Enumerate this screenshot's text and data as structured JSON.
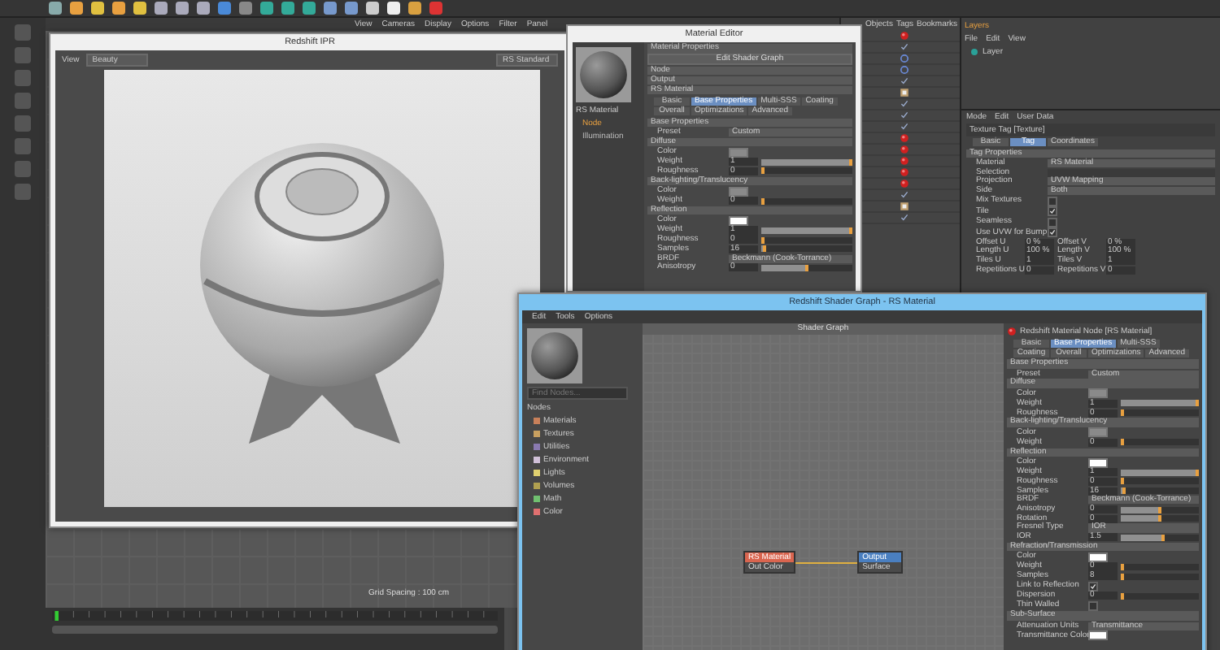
{
  "viewport": {
    "menu": [
      "View",
      "Cameras",
      "Display",
      "Options",
      "Filter",
      "Panel"
    ],
    "grid_spacing": "Grid Spacing : 100 cm"
  },
  "ipr": {
    "title": "Redshift IPR",
    "menu": [
      "View"
    ],
    "dropdown": "Beauty",
    "aov": "RS Standard"
  },
  "object_manager": {
    "menu": [
      "Objects",
      "Tags",
      "Bookmarks"
    ],
    "rows": [
      {
        "kind": "material"
      },
      {
        "kind": "plain"
      },
      {
        "kind": "null"
      },
      {
        "kind": "null"
      },
      {
        "kind": "plain"
      },
      {
        "kind": "texture"
      },
      {
        "kind": "plain"
      },
      {
        "kind": "plain"
      },
      {
        "kind": "plain"
      },
      {
        "kind": "material"
      },
      {
        "kind": "material"
      },
      {
        "kind": "material"
      },
      {
        "kind": "material"
      },
      {
        "kind": "material"
      },
      {
        "kind": "plain"
      },
      {
        "kind": "texture"
      },
      {
        "kind": "plain"
      }
    ]
  },
  "layers": {
    "tab": "Layers",
    "menu": [
      "File",
      "Edit",
      "View"
    ],
    "rows": [
      {
        "label": "Layer",
        "color": "#2aa198"
      }
    ]
  },
  "attributes": {
    "menu": [
      "Mode",
      "Edit",
      "User Data"
    ],
    "title": "Texture Tag [Texture]",
    "props": [
      {
        "kind": "tabs",
        "tabs": [
          {
            "label": "Basic",
            "selected": false
          },
          {
            "label": "Tag",
            "selected": true
          },
          {
            "label": "Coordinates",
            "selected": false
          }
        ]
      },
      {
        "kind": "section",
        "label": "Tag Properties"
      },
      {
        "kind": "dropdown",
        "label": "Material",
        "value": "RS Material"
      },
      {
        "kind": "text",
        "label": "Selection"
      },
      {
        "kind": "dropdown",
        "label": "Projection",
        "value": "UVW Mapping"
      },
      {
        "kind": "dropdown",
        "label": "Side",
        "value": "Both"
      },
      {
        "kind": "check",
        "label": "Mix Textures",
        "checked": false
      },
      {
        "kind": "check",
        "label": "Tile",
        "checked": true
      },
      {
        "kind": "check",
        "label": "Seamless",
        "checked": false
      },
      {
        "kind": "check",
        "label": "Use UVW for Bump",
        "checked": true
      },
      {
        "kind": "pair",
        "label": "Offset U",
        "value": "0 %",
        "label2": "Offset V",
        "value2": "0 %"
      },
      {
        "kind": "pair",
        "label": "Length U",
        "value": "100 %",
        "label2": "Length V",
        "value2": "100 %"
      },
      {
        "kind": "pair",
        "label": "Tiles U",
        "value": "1",
        "label2": "Tiles V",
        "value2": "1"
      },
      {
        "kind": "pair",
        "label": "Repetitions U",
        "value": "0",
        "label2": "Repetitions V",
        "value2": "0"
      }
    ]
  },
  "material_editor": {
    "title": "Material Editor",
    "material": "RS Material",
    "channels": [
      {
        "label": "Node",
        "selected": true
      },
      {
        "label": "Illumination",
        "selected": false
      }
    ],
    "props": [
      {
        "kind": "section",
        "label": "Material Properties"
      },
      {
        "kind": "button",
        "label": "Edit Shader Graph"
      },
      {
        "kind": "section",
        "label": "Node"
      },
      {
        "kind": "section",
        "label": "Output"
      },
      {
        "kind": "section",
        "label": "RS Material"
      },
      {
        "kind": "tabs",
        "tabs": [
          {
            "label": "Basic",
            "selected": false
          },
          {
            "label": "Base Properties",
            "selected": true
          },
          {
            "label": "Multi-SSS",
            "selected": false
          },
          {
            "label": "Coating",
            "selected": false
          },
          {
            "label": "Overall",
            "selected": false
          },
          {
            "label": "Optimizations",
            "selected": false
          },
          {
            "label": "Advanced",
            "selected": false
          }
        ]
      },
      {
        "kind": "section",
        "label": "Base Properties"
      },
      {
        "kind": "dropdown",
        "label": "Preset",
        "value": "Custom"
      },
      {
        "kind": "section",
        "label": "Diffuse"
      },
      {
        "kind": "color",
        "label": "Color",
        "color": "#8a8a8a"
      },
      {
        "kind": "number",
        "label": "Weight",
        "value": "1",
        "level": 1
      },
      {
        "kind": "number",
        "label": "Roughness",
        "value": "0",
        "level": 0
      },
      {
        "kind": "section",
        "label": "Back-lighting/Translucency"
      },
      {
        "kind": "color",
        "label": "Color",
        "color": "#8a8a8a"
      },
      {
        "kind": "number",
        "label": "Weight",
        "value": "0",
        "level": 0
      },
      {
        "kind": "section",
        "label": "Reflection"
      },
      {
        "kind": "color",
        "label": "Color",
        "color": "#ffffff"
      },
      {
        "kind": "number",
        "label": "Weight",
        "value": "1",
        "level": 1
      },
      {
        "kind": "number",
        "label": "Roughness",
        "value": "0",
        "level": 0
      },
      {
        "kind": "number",
        "label": "Samples",
        "value": "16",
        "level": 0.02
      },
      {
        "kind": "dropdown",
        "label": "BRDF",
        "value": "Beckmann (Cook-Torrance)"
      },
      {
        "kind": "number",
        "label": "Anisotropy",
        "value": "0",
        "level": 0.5
      }
    ]
  },
  "shader_graph": {
    "title": "Redshift Shader Graph - RS Material",
    "menu": [
      "Edit",
      "Tools",
      "Options"
    ],
    "search": {
      "placeholder": "Find Nodes..."
    },
    "nodes_header": "Nodes",
    "categories": [
      {
        "label": "Materials",
        "color": "#c8805a"
      },
      {
        "label": "Textures",
        "color": "#c8a060"
      },
      {
        "label": "Utilities",
        "color": "#8a7ab0"
      },
      {
        "label": "Environment",
        "color": "#d0c0d8"
      },
      {
        "label": "Lights",
        "color": "#e0d070"
      },
      {
        "label": "Volumes",
        "color": "#b0a050"
      },
      {
        "label": "Math",
        "color": "#70c070"
      },
      {
        "label": "Color",
        "color": "#e07070"
      }
    ],
    "canvas_title": "Shader Graph",
    "graph_nodes": [
      {
        "title": "RS Material",
        "port": "Out Color",
        "color": "#d9654f"
      },
      {
        "title": "Output",
        "port": "Surface",
        "color": "#4a7fc0"
      }
    ],
    "panel_title": "Redshift Material Node [RS Material]",
    "props": [
      {
        "kind": "tabs",
        "tabs": [
          {
            "label": "Basic",
            "selected": false
          },
          {
            "label": "Base Properties",
            "selected": true
          },
          {
            "label": "Multi-SSS",
            "selected": false
          },
          {
            "label": "Coating",
            "selected": false
          },
          {
            "label": "Overall",
            "selected": false
          },
          {
            "label": "Optimizations",
            "selected": false
          },
          {
            "label": "Advanced",
            "selected": false
          }
        ]
      },
      {
        "kind": "section",
        "label": "Base Properties"
      },
      {
        "kind": "dropdown",
        "label": "Preset",
        "value": "Custom"
      },
      {
        "kind": "section",
        "label": "Diffuse"
      },
      {
        "kind": "color",
        "label": "Color",
        "color": "#8a8a8a"
      },
      {
        "kind": "number",
        "label": "Weight",
        "value": "1",
        "level": 1
      },
      {
        "kind": "number",
        "label": "Roughness",
        "value": "0",
        "level": 0
      },
      {
        "kind": "section",
        "label": "Back-lighting/Translucency"
      },
      {
        "kind": "color",
        "label": "Color",
        "color": "#8a8a8a"
      },
      {
        "kind": "number",
        "label": "Weight",
        "value": "0",
        "level": 0
      },
      {
        "kind": "section",
        "label": "Reflection"
      },
      {
        "kind": "color",
        "label": "Color",
        "color": "#ffffff"
      },
      {
        "kind": "number",
        "label": "Weight",
        "value": "1",
        "level": 1
      },
      {
        "kind": "number",
        "label": "Roughness",
        "value": "0",
        "level": 0
      },
      {
        "kind": "number",
        "label": "Samples",
        "value": "16",
        "level": 0.02
      },
      {
        "kind": "dropdown",
        "label": "BRDF",
        "value": "Beckmann (Cook-Torrance)"
      },
      {
        "kind": "number",
        "label": "Anisotropy",
        "value": "0",
        "level": 0.5
      },
      {
        "kind": "number",
        "label": "Rotation",
        "value": "0",
        "level": 0.5
      },
      {
        "kind": "dropdown",
        "label": "Fresnel Type",
        "value": "IOR"
      },
      {
        "kind": "number",
        "label": "IOR",
        "value": "1.5",
        "level": 0.55
      },
      {
        "kind": "section",
        "label": "Refraction/Transmission"
      },
      {
        "kind": "color",
        "label": "Color",
        "color": "#ffffff"
      },
      {
        "kind": "number",
        "label": "Weight",
        "value": "0",
        "level": 0
      },
      {
        "kind": "number",
        "label": "Samples",
        "value": "8",
        "level": 0.01
      },
      {
        "kind": "check",
        "label": "Link to Reflection",
        "checked": true
      },
      {
        "kind": "number",
        "label": "Dispersion",
        "value": "0",
        "level": 0
      },
      {
        "kind": "check",
        "label": "Thin Walled",
        "checked": false
      },
      {
        "kind": "section",
        "label": "Sub-Surface"
      },
      {
        "kind": "dropdown",
        "label": "Attenuation Units",
        "value": "Transmittance"
      },
      {
        "kind": "color",
        "label": "Transmittance Color",
        "color": "#ffffff"
      }
    ]
  }
}
